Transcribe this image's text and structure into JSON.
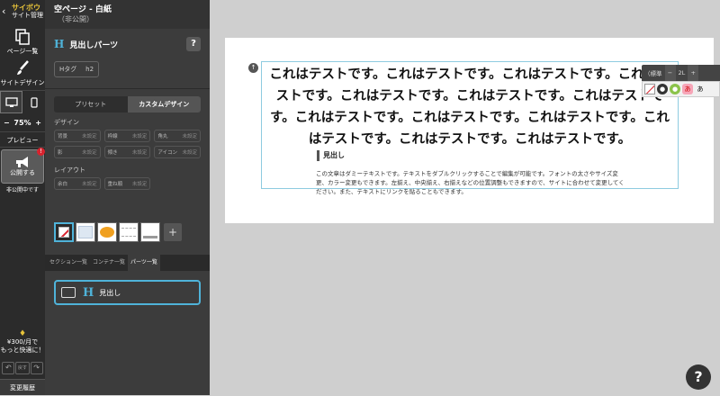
{
  "rail": {
    "brand_name": "サイボウ",
    "brand_sub": "サイト管理",
    "pages_label": "ページ一覧",
    "design_label": "サイトデザイン",
    "zoom_minus": "−",
    "zoom_value": "75%",
    "zoom_plus": "+",
    "preview_label": "プレビュー",
    "publish_label": "公開する",
    "publish_badge": "!",
    "publish_status": "非公開中です",
    "upsell_price": "¥300/月で",
    "upsell_sub": "もっと快適に！",
    "undo_mid": "戻す",
    "history_label": "変更履歴"
  },
  "panel": {
    "page_title": "空ページ - 白紙",
    "page_status": "（非公開）",
    "parts_title": "見出しパーツ",
    "help": "?",
    "tag_label": "Hタグ",
    "tag_value": "h2",
    "tabs": [
      "プリセット",
      "カスタムデザイン"
    ],
    "design_label": "デザイン",
    "design_props": [
      {
        "name": "背景",
        "value": "未設定"
      },
      {
        "name": "枠線",
        "value": "未設定"
      },
      {
        "name": "角丸",
        "value": "未設定"
      },
      {
        "name": "影",
        "value": "未設定"
      },
      {
        "name": "傾き",
        "value": "未設定"
      },
      {
        "name": "アイコン",
        "value": "未設定"
      }
    ],
    "layout_label": "レイアウト",
    "layout_props": [
      {
        "name": "余白",
        "value": "未設定"
      },
      {
        "name": "重ね順",
        "value": "未設定"
      }
    ],
    "add_swatch": "+",
    "lower_tabs": [
      "セクション一覧",
      "コンテナ一覧",
      "パーツ一覧"
    ],
    "part_card_label": "見出し"
  },
  "canvas": {
    "heading_text": "これはテストです。これはテストです。これはテストです。これはテストです。これはテストです。これはテストです。これはテストです。これはテストです。これはテストです。これはテストです。これはテストです。これはテストです。これはテストです。",
    "sub_heading": "見出し",
    "body_text": "この文章はダミーテキストです。テキストをダブルクリックすることで編集が可能です。フォントの太さやサイズ変更、カラー変更もできます。左揃え、中央揃え、右揃えなどの位置調整もできますので、サイトに合わせて変更してください。また、テキストにリンクを貼ることもできます。"
  },
  "toolbar": {
    "font_label": "（標準",
    "minus": "−",
    "size": "2L",
    "plus": "+",
    "last_btn": "あ"
  },
  "help_button": "?",
  "colors": {
    "accent": "#4fb3d9",
    "brand": "#e6c23a",
    "alert": "#d9232e"
  }
}
